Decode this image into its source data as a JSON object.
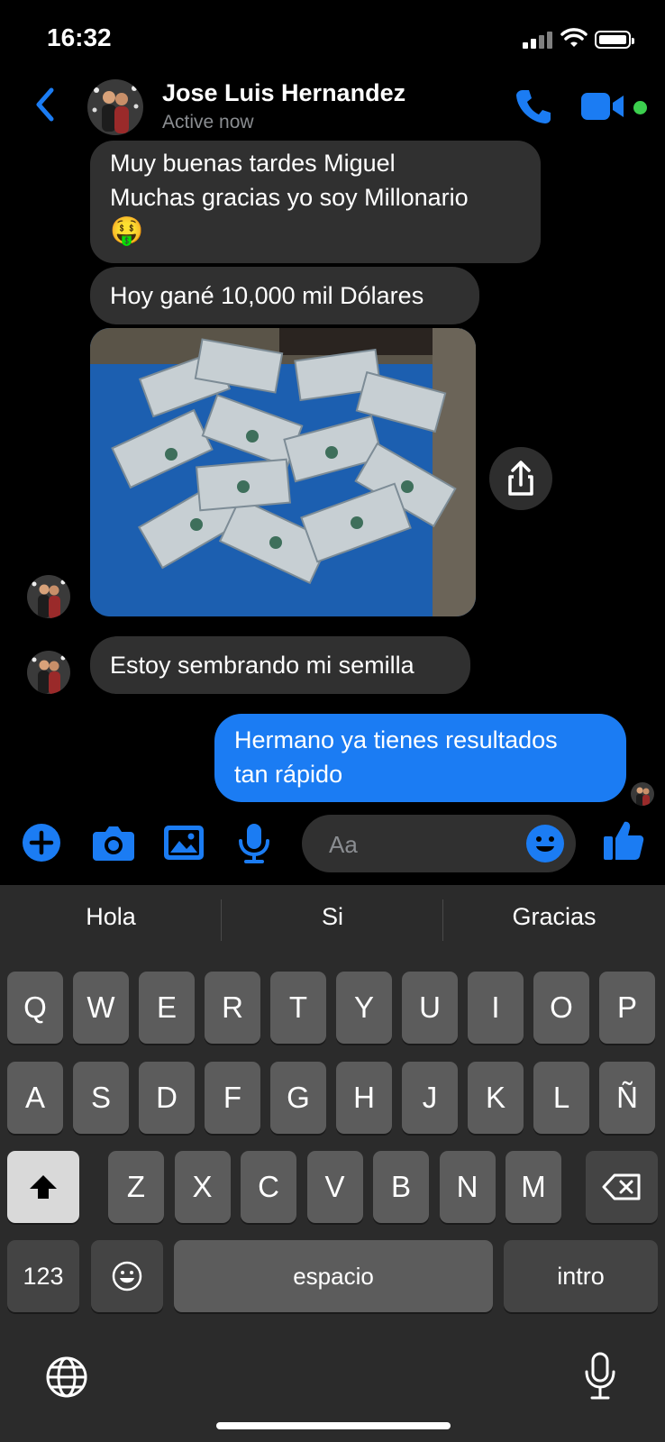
{
  "status_bar": {
    "time": "16:32"
  },
  "header": {
    "back_icon": "chevron-left-icon",
    "contact_name": "Jose Luis Hernandez",
    "status": "Active now",
    "accent_color": "#1b7cf3",
    "online_color": "#3ccf4e"
  },
  "messages": [
    {
      "sender": "contact",
      "lines": [
        "Muy buenas tardes Miguel",
        "Muchas gracias yo soy Millonario",
        "🤑"
      ]
    },
    {
      "sender": "contact",
      "text": "Hoy gané 10,000 mil Dólares"
    },
    {
      "sender": "contact",
      "type": "photo",
      "content": "stacks of 100 dollar bills on a blue towel"
    },
    {
      "sender": "contact",
      "text": "Estoy sembrando mi semilla"
    },
    {
      "sender": "me",
      "lines": [
        "Hermano ya tienes resultados",
        "tan rápido"
      ]
    }
  ],
  "composer": {
    "placeholder": "Aa",
    "icons": [
      "plus-icon",
      "camera-icon",
      "gallery-icon",
      "microphone-icon",
      "emoji-icon",
      "like-icon"
    ]
  },
  "keyboard": {
    "suggestions": [
      "Hola",
      "Si",
      "Gracias"
    ],
    "row1": [
      "Q",
      "W",
      "E",
      "R",
      "T",
      "Y",
      "U",
      "I",
      "O",
      "P"
    ],
    "row2": [
      "A",
      "S",
      "D",
      "F",
      "G",
      "H",
      "J",
      "K",
      "L",
      "Ñ"
    ],
    "row3": [
      "Z",
      "X",
      "C",
      "V",
      "B",
      "N",
      "M"
    ],
    "numbers_key": "123",
    "space_key": "espacio",
    "return_key": "intro"
  }
}
